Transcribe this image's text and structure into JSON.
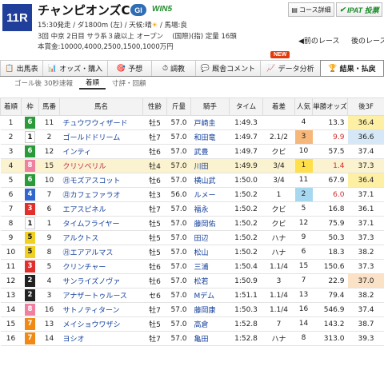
{
  "race": {
    "number": "11R",
    "name": "チャンピオンズC",
    "grade": "GI",
    "win5": "WIN5",
    "line1": "15:30発走 / ダ1800m (左) / 天候:晴",
    "line1_track": " / 馬場:良",
    "line2": "3回 中京 2日目 サラ系３歳以上 オープン　 (国際)(指) 定量 16頭",
    "line3": "本賞金:10000,4000,2500,1500,1000万円"
  },
  "buttons": {
    "course": "コース詳細",
    "ipat": "IPAT 投票"
  },
  "nav": {
    "prev": "◀前のレース",
    "next": "後のレース▶"
  },
  "new_badge": "NEW",
  "tabs": [
    {
      "label": "出馬表",
      "icon": "📋"
    },
    {
      "label": "オッズ・購入",
      "icon": "📊"
    },
    {
      "label": "予想",
      "icon": "🎯"
    },
    {
      "label": "調教",
      "icon": "⏱"
    },
    {
      "label": "厩舎コメント",
      "icon": "💬"
    },
    {
      "label": "データ分析",
      "icon": "📈"
    },
    {
      "label": "結果・払戻",
      "icon": "🏆"
    }
  ],
  "subtabs": [
    "ゴール後 30秒速報",
    "着順",
    "寸評・回顧"
  ],
  "columns": [
    "着順",
    "枠",
    "馬番",
    "馬名",
    "性齢",
    "斤量",
    "騎手",
    "タイム",
    "着差",
    "人気",
    "単勝オッズ",
    "後3F"
  ],
  "colors": {
    "header_blue": "#1f3f9a",
    "link_blue": "#133f9c",
    "highlight_row": "#fbf2d0"
  },
  "rows": [
    {
      "pos": "1",
      "waku": "6",
      "umaban": "11",
      "name": "チュウワウィザード",
      "sexage": "牡5",
      "kin": "57.0",
      "jockey": "戸崎圭",
      "time": "1:49.3",
      "margin": "",
      "pop": "4",
      "odds": "13.3",
      "last3f": "36.4",
      "f3rank": 1,
      "hl": false,
      "red": false
    },
    {
      "pos": "2",
      "waku": "1",
      "umaban": "2",
      "name": "ゴールドドリーム",
      "sexage": "牡7",
      "kin": "57.0",
      "jockey": "和田竜",
      "time": "1:49.7",
      "margin": "2.1/2",
      "pop": "3",
      "odds": "9.9",
      "last3f": "36.6",
      "f3rank": 2,
      "hl": false,
      "red": true
    },
    {
      "pos": "3",
      "waku": "6",
      "umaban": "12",
      "name": "インティ",
      "sexage": "牡6",
      "kin": "57.0",
      "jockey": "武豊",
      "time": "1:49.7",
      "margin": "クビ",
      "pop": "10",
      "odds": "57.5",
      "last3f": "37.4",
      "f3rank": 0,
      "hl": false,
      "red": false
    },
    {
      "pos": "4",
      "waku": "8",
      "umaban": "15",
      "name": "クリソベリル",
      "sexage": "牡4",
      "kin": "57.0",
      "jockey": "川田",
      "time": "1:49.9",
      "margin": "3/4",
      "pop": "1",
      "odds": "1.4",
      "last3f": "37.3",
      "f3rank": 0,
      "hl": true,
      "red": true
    },
    {
      "pos": "5",
      "waku": "6",
      "umaban": "10",
      "name": "㊊モズアスコット",
      "sexage": "牡6",
      "kin": "57.0",
      "jockey": "横山武",
      "time": "1:50.0",
      "margin": "3/4",
      "pop": "11",
      "odds": "67.9",
      "last3f": "36.4",
      "f3rank": 1,
      "hl": false,
      "red": false
    },
    {
      "pos": "6",
      "waku": "4",
      "umaban": "7",
      "name": "㊊カフェファラオ",
      "sexage": "牡3",
      "kin": "56.0",
      "jockey": "ルメー",
      "time": "1:50.2",
      "margin": "1",
      "pop": "2",
      "odds": "6.0",
      "last3f": "37.1",
      "f3rank": 0,
      "hl": false,
      "red": true
    },
    {
      "pos": "7",
      "waku": "3",
      "umaban": "6",
      "name": "エアスピネル",
      "sexage": "牡7",
      "kin": "57.0",
      "jockey": "福永",
      "time": "1:50.2",
      "margin": "クビ",
      "pop": "5",
      "odds": "16.8",
      "last3f": "36.1",
      "f3rank": 0,
      "hl": false,
      "red": false
    },
    {
      "pos": "8",
      "waku": "1",
      "umaban": "1",
      "name": "タイムフライヤー",
      "sexage": "牡5",
      "kin": "57.0",
      "jockey": "藤岡佑",
      "time": "1:50.2",
      "margin": "クビ",
      "pop": "12",
      "odds": "75.9",
      "last3f": "37.1",
      "f3rank": 0,
      "hl": false,
      "red": false
    },
    {
      "pos": "9",
      "waku": "5",
      "umaban": "9",
      "name": "アルクトス",
      "sexage": "牡5",
      "kin": "57.0",
      "jockey": "田辺",
      "time": "1:50.2",
      "margin": "ハナ",
      "pop": "9",
      "odds": "50.3",
      "last3f": "37.3",
      "f3rank": 0,
      "hl": false,
      "red": false
    },
    {
      "pos": "10",
      "waku": "5",
      "umaban": "8",
      "name": "㊊エアアルマス",
      "sexage": "牡5",
      "kin": "57.0",
      "jockey": "松山",
      "time": "1:50.2",
      "margin": "ハナ",
      "pop": "6",
      "odds": "18.3",
      "last3f": "38.2",
      "f3rank": 0,
      "hl": false,
      "red": false
    },
    {
      "pos": "11",
      "waku": "3",
      "umaban": "5",
      "name": "クリンチャー",
      "sexage": "牡6",
      "kin": "57.0",
      "jockey": "三浦",
      "time": "1:50.4",
      "margin": "1.1/4",
      "pop": "15",
      "odds": "150.6",
      "last3f": "37.3",
      "f3rank": 0,
      "hl": false,
      "red": false
    },
    {
      "pos": "12",
      "waku": "2",
      "umaban": "4",
      "name": "サンライズノヴァ",
      "sexage": "牡6",
      "kin": "57.0",
      "jockey": "松若",
      "time": "1:50.9",
      "margin": "3",
      "pop": "7",
      "odds": "22.9",
      "last3f": "37.0",
      "f3rank": 3,
      "hl": false,
      "red": false
    },
    {
      "pos": "13",
      "waku": "2",
      "umaban": "3",
      "name": "アナザートゥルース",
      "sexage": "セ6",
      "kin": "57.0",
      "jockey": "Mデム",
      "time": "1:51.1",
      "margin": "1.1/4",
      "pop": "13",
      "odds": "79.4",
      "last3f": "38.2",
      "f3rank": 0,
      "hl": false,
      "red": false
    },
    {
      "pos": "14",
      "waku": "8",
      "umaban": "16",
      "name": "サトノティターン",
      "sexage": "牡7",
      "kin": "57.0",
      "jockey": "藤岡康",
      "time": "1:50.3",
      "margin": "1.1/4",
      "pop": "16",
      "odds": "546.9",
      "last3f": "37.4",
      "f3rank": 0,
      "hl": false,
      "red": false
    },
    {
      "pos": "15",
      "waku": "7",
      "umaban": "13",
      "name": "メイショウワザシ",
      "sexage": "牡5",
      "kin": "57.0",
      "jockey": "高倉",
      "time": "1:52.8",
      "margin": "7",
      "pop": "14",
      "odds": "143.2",
      "last3f": "38.7",
      "f3rank": 0,
      "hl": false,
      "red": false
    },
    {
      "pos": "16",
      "waku": "7",
      "umaban": "14",
      "name": "ヨシオ",
      "sexage": "牡7",
      "kin": "57.0",
      "jockey": "亀田",
      "time": "1:52.8",
      "margin": "ハナ",
      "pop": "8",
      "odds": "313.0",
      "last3f": "39.3",
      "f3rank": 0,
      "hl": false,
      "red": false
    }
  ]
}
